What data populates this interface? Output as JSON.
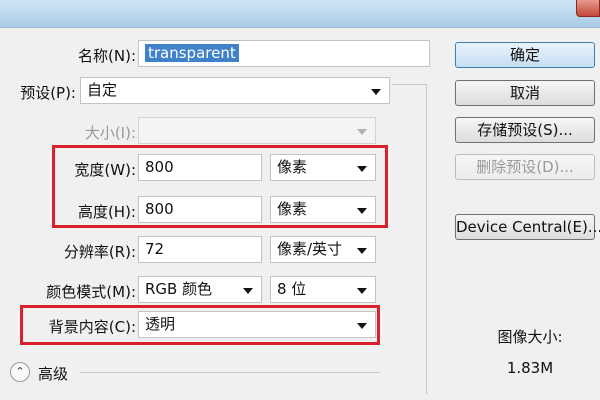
{
  "dialog": {
    "name_label": "名称(N):",
    "name_value": "transparent",
    "preset_label": "预设(P):",
    "preset_value": "自定",
    "size_label": "大小(I):",
    "width_label": "宽度(W):",
    "width_value": "800",
    "width_unit": "像素",
    "height_label": "高度(H):",
    "height_value": "800",
    "height_unit": "像素",
    "resolution_label": "分辨率(R):",
    "resolution_value": "72",
    "resolution_unit": "像素/英寸",
    "color_mode_label": "颜色模式(M):",
    "color_mode_value": "RGB 颜色",
    "bit_depth_value": "8 位",
    "background_label": "背景内容(C):",
    "background_value": "透明",
    "advanced_label": "高级"
  },
  "buttons": {
    "ok": "确定",
    "cancel": "取消",
    "save_preset": "存储预设(S)...",
    "delete_preset": "删除预设(D)...",
    "device_central": "Device Central(E)..."
  },
  "image_size": {
    "label": "图像大小:",
    "value": "1.83M"
  },
  "colors": {
    "highlight_box": "#d8202a",
    "selection": "#3f82c9"
  }
}
